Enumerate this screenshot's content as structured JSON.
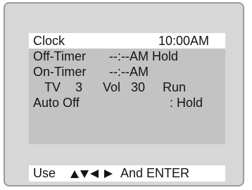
{
  "menu": {
    "clock": {
      "label": "Clock",
      "value": "10:00AM"
    },
    "off_timer": {
      "label": "Off-Timer",
      "value": "--:--AM Hold"
    },
    "on_timer": {
      "label": "On-Timer",
      "value": "--:--AM"
    },
    "tv_row": {
      "tv_label": "TV",
      "channel": "3",
      "vol_label": "Vol",
      "volume": "30",
      "mode": "Run"
    },
    "auto_off": {
      "label": "Auto Off",
      "value": ": Hold"
    }
  },
  "hint": {
    "prefix": "Use",
    "arrow_icons": [
      "arrow-up-icon",
      "arrow-down-icon",
      "arrow-left-icon",
      "arrow-right-icon"
    ],
    "suffix": "And ENTER"
  },
  "colors": {
    "frame_bg": "#d7d7d7",
    "menu_bg": "#c3c3c3",
    "highlight_bg": "#ffffff",
    "text": "#141414"
  }
}
